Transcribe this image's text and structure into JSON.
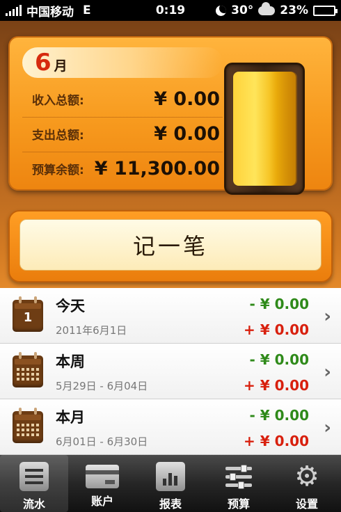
{
  "status_bar": {
    "carrier": "中国移动",
    "network": "E",
    "time": "0:19",
    "temperature": "30°",
    "battery": "23%",
    "battery_level": 0.23
  },
  "summary": {
    "month_number": "6",
    "month_unit": "月",
    "rows": [
      {
        "label": "收入总额:",
        "value": "¥ 0.00"
      },
      {
        "label": "支出总额:",
        "value": "¥ 0.00"
      },
      {
        "label": "预算余额:",
        "value": "¥ 11,300.00"
      }
    ]
  },
  "record_button": {
    "label": "记一笔"
  },
  "periods": [
    {
      "title": "今天",
      "range": "2011年6月1日",
      "expense": "- ¥ 0.00",
      "income": "+ ¥ 0.00",
      "calendar_day": "1"
    },
    {
      "title": "本周",
      "range": "5月29日 - 6月04日",
      "expense": "- ¥ 0.00",
      "income": "+ ¥ 0.00"
    },
    {
      "title": "本月",
      "range": "6月01日 - 6月30日",
      "expense": "- ¥ 0.00",
      "income": "+ ¥ 0.00"
    }
  ],
  "tabs": [
    {
      "label": "流水",
      "icon": "list-icon",
      "active": true
    },
    {
      "label": "账户",
      "icon": "account-card-icon",
      "active": false
    },
    {
      "label": "报表",
      "icon": "report-icon",
      "active": false
    },
    {
      "label": "预算",
      "icon": "budget-sliders-icon",
      "active": false
    },
    {
      "label": "设置",
      "icon": "gear-icon",
      "active": false
    }
  ],
  "colors": {
    "expense": "#2f8a1a",
    "income": "#d8200e",
    "month_accent": "#d62a0e",
    "card_orange": "#f79a1e"
  }
}
